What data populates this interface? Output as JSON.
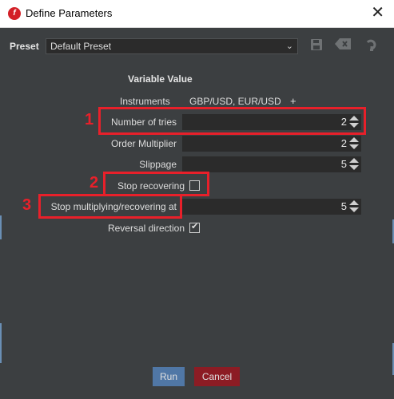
{
  "window": {
    "title": "Define Parameters",
    "logo_text": "f"
  },
  "preset": {
    "label": "Preset",
    "value": "Default Preset"
  },
  "header": {
    "text": "Variable Value"
  },
  "instruments": {
    "label": "Instruments",
    "value": "GBP/USD, EUR/USD",
    "add": "+"
  },
  "rows": {
    "tries": {
      "label": "Number of tries",
      "value": "2"
    },
    "multiplier": {
      "label": "Order Multiplier",
      "value": "2"
    },
    "slippage": {
      "label": "Slippage",
      "value": "5"
    },
    "stop_recovering": {
      "label": "Stop recovering",
      "checked": false
    },
    "stop_mult": {
      "label": "Stop multiplying/recovering at",
      "value": "5"
    },
    "reversal": {
      "label": "Reversal direction",
      "checked": true
    }
  },
  "annotations": [
    "1",
    "2",
    "3"
  ],
  "buttons": {
    "run": "Run",
    "cancel": "Cancel"
  },
  "colors": {
    "highlight": "#e8202a",
    "run": "#5077a6",
    "cancel": "#8c1c24",
    "panel": "#3c3f41"
  }
}
